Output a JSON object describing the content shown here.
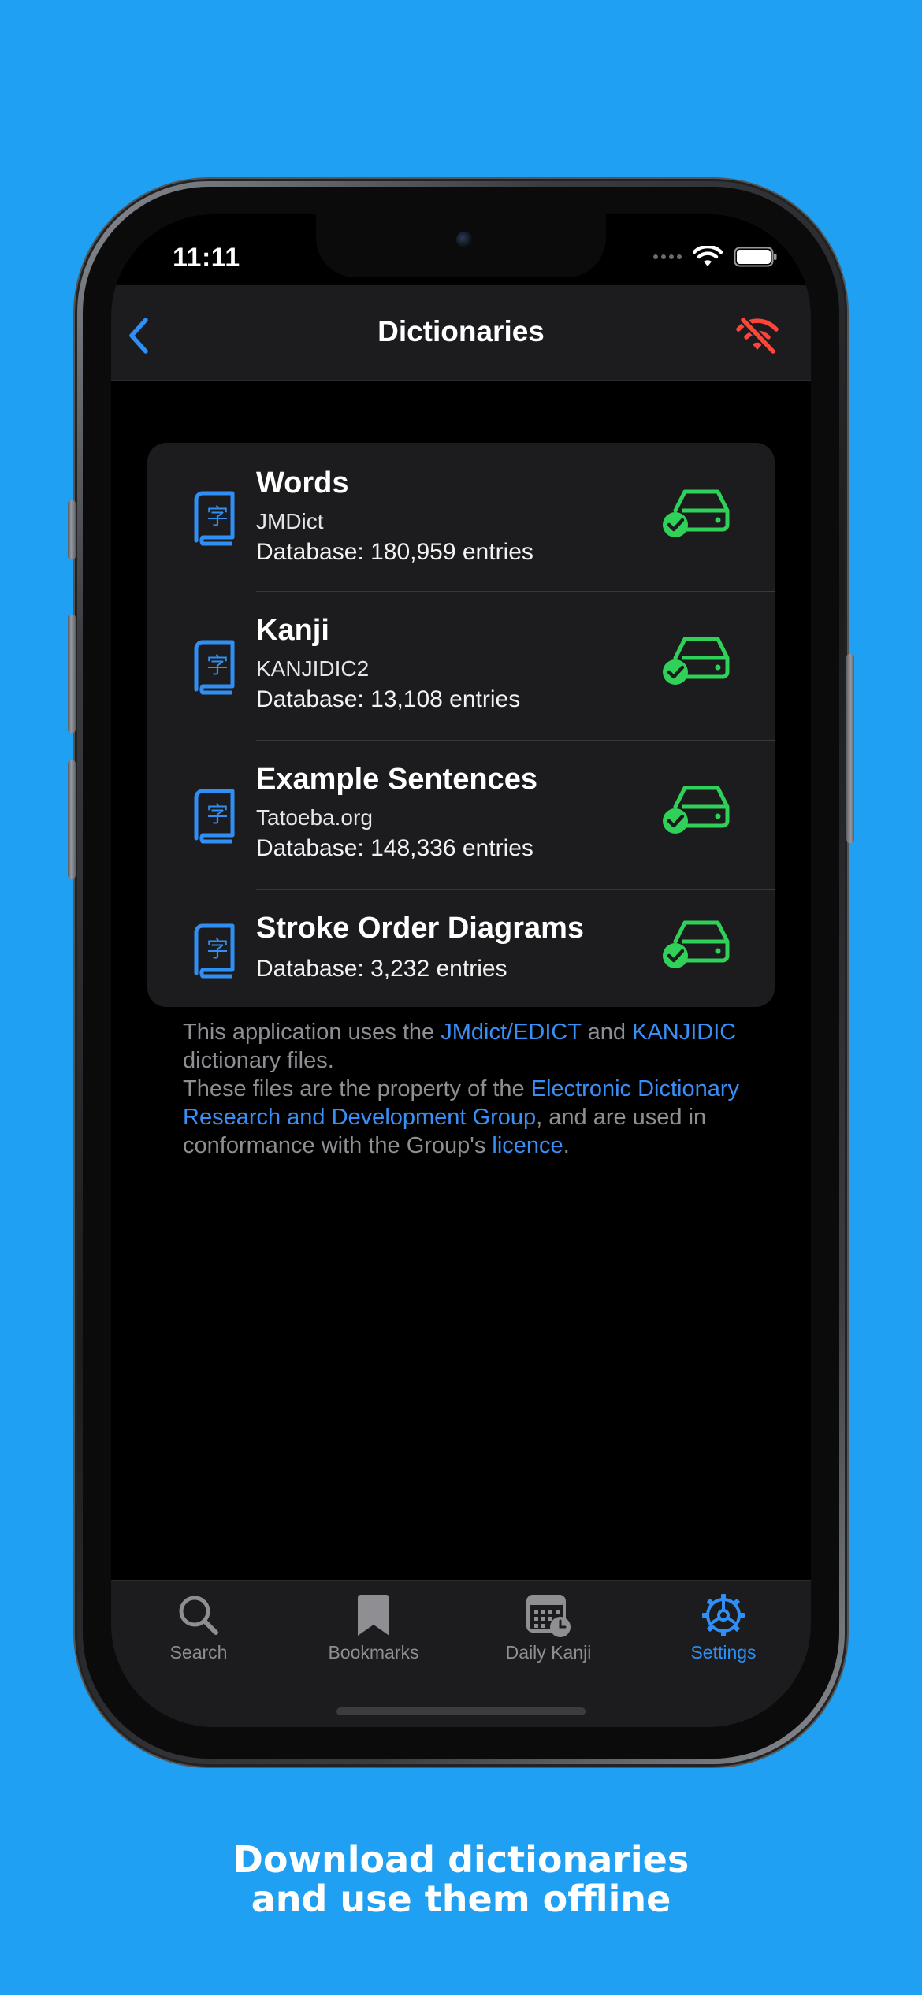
{
  "status_bar": {
    "time": "11:11"
  },
  "nav": {
    "title": "Dictionaries",
    "back_icon": "chevron-left-icon",
    "offline_icon": "wifi-slash-icon",
    "accent_color": "#2f8ff5",
    "offline_color": "#ff453a"
  },
  "dictionaries": [
    {
      "title": "Words",
      "source": "JMDict",
      "database": "Database: 180,959 entries",
      "icon": "kanji-book-icon",
      "status_icon": "downloaded-drive-icon"
    },
    {
      "title": "Kanji",
      "source": "KANJIDIC2",
      "database": "Database: 13,108 entries",
      "icon": "kanji-book-icon",
      "status_icon": "downloaded-drive-icon"
    },
    {
      "title": "Example Sentences",
      "source": "Tatoeba.org",
      "database": "Database: 148,336 entries",
      "icon": "kanji-book-icon",
      "status_icon": "downloaded-drive-icon"
    },
    {
      "title": "Stroke Order Diagrams",
      "source": "",
      "database": "Database: 3,232 entries",
      "icon": "kanji-book-icon",
      "status_icon": "downloaded-drive-icon"
    }
  ],
  "footnote": {
    "t1": "This application uses the ",
    "link_jmdict": "JMdict/EDICT",
    "t2": " and ",
    "link_kanjidic": "KANJIDIC",
    "t3": " dictionary files.",
    "t4": "These files are the property of the ",
    "link_edrdg": "Electronic Dictionary Research and Development Group",
    "t5": ", and are used in conformance with the Group's ",
    "link_licence": "licence",
    "t6": "."
  },
  "tabs": [
    {
      "label": "Search",
      "icon": "magnifier-icon",
      "active": false
    },
    {
      "label": "Bookmarks",
      "icon": "bookmark-icon",
      "active": false
    },
    {
      "label": "Daily Kanji",
      "icon": "calendar-clock-icon",
      "active": false
    },
    {
      "label": "Settings",
      "icon": "gear-icon",
      "active": true
    }
  ],
  "caption": {
    "line1": "Download dictionaries",
    "line2": "and use them offline"
  },
  "colors": {
    "background": "#1fa0f2",
    "status_green": "#30d158",
    "link_blue": "#3a8ff7"
  }
}
